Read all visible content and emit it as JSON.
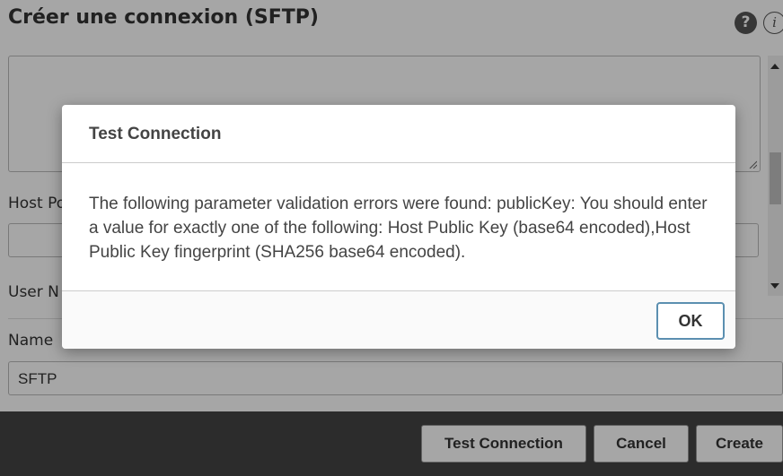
{
  "page": {
    "title": "Créer une connexion (SFTP)",
    "help_glyph": "?",
    "info_glyph": "i"
  },
  "form": {
    "host_port_label": "Host Po",
    "user_name_label": "User N",
    "name_label": "Name",
    "name_value": "SFTP"
  },
  "footer": {
    "test_connection_label": "Test Connection",
    "cancel_label": "Cancel",
    "create_label": "Create"
  },
  "dialog": {
    "title": "Test Connection",
    "message": "The following parameter validation errors were found: publicKey: You should enter a value for exactly one of the following: Host Public Key (base64 encoded),Host Public Key fingerprint (SHA256 base64 encoded).",
    "ok_label": "OK"
  },
  "colors": {
    "footer_bg": "#444444",
    "ok_border": "#5b8fb0",
    "overlay": "rgba(0,0,0,0.35)"
  }
}
